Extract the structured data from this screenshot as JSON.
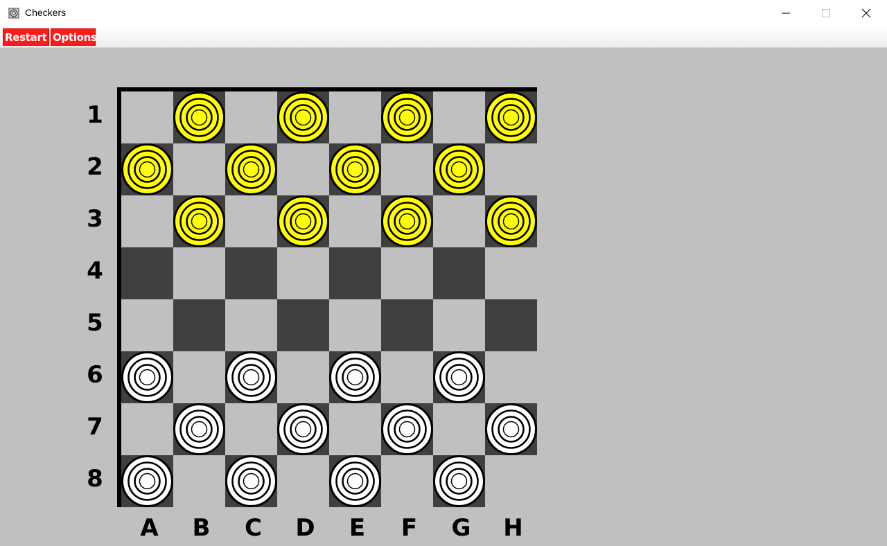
{
  "window": {
    "title": "Checkers"
  },
  "menu": {
    "restart_label": "Restart",
    "options_label": "Options"
  },
  "board": {
    "rank_labels": [
      "1",
      "2",
      "3",
      "4",
      "5",
      "6",
      "7",
      "8"
    ],
    "file_labels": [
      "A",
      "B",
      "C",
      "D",
      "E",
      "F",
      "G",
      "H"
    ],
    "colors": {
      "light_square": "#c0c0c0",
      "dark_square": "#404040",
      "yellow_piece": "#ffff00",
      "white_piece": "#ffffff"
    },
    "pieces": [
      {
        "color": "yellow",
        "square": "B1"
      },
      {
        "color": "yellow",
        "square": "D1"
      },
      {
        "color": "yellow",
        "square": "F1"
      },
      {
        "color": "yellow",
        "square": "H1"
      },
      {
        "color": "yellow",
        "square": "A2"
      },
      {
        "color": "yellow",
        "square": "C2"
      },
      {
        "color": "yellow",
        "square": "E2"
      },
      {
        "color": "yellow",
        "square": "G2"
      },
      {
        "color": "yellow",
        "square": "B3"
      },
      {
        "color": "yellow",
        "square": "D3"
      },
      {
        "color": "yellow",
        "square": "F3"
      },
      {
        "color": "yellow",
        "square": "H3"
      },
      {
        "color": "white",
        "square": "A6"
      },
      {
        "color": "white",
        "square": "C6"
      },
      {
        "color": "white",
        "square": "E6"
      },
      {
        "color": "white",
        "square": "G6"
      },
      {
        "color": "white",
        "square": "B7"
      },
      {
        "color": "white",
        "square": "D7"
      },
      {
        "color": "white",
        "square": "F7"
      },
      {
        "color": "white",
        "square": "H7"
      },
      {
        "color": "white",
        "square": "A8"
      },
      {
        "color": "white",
        "square": "C8"
      },
      {
        "color": "white",
        "square": "E8"
      },
      {
        "color": "white",
        "square": "G8"
      }
    ]
  }
}
